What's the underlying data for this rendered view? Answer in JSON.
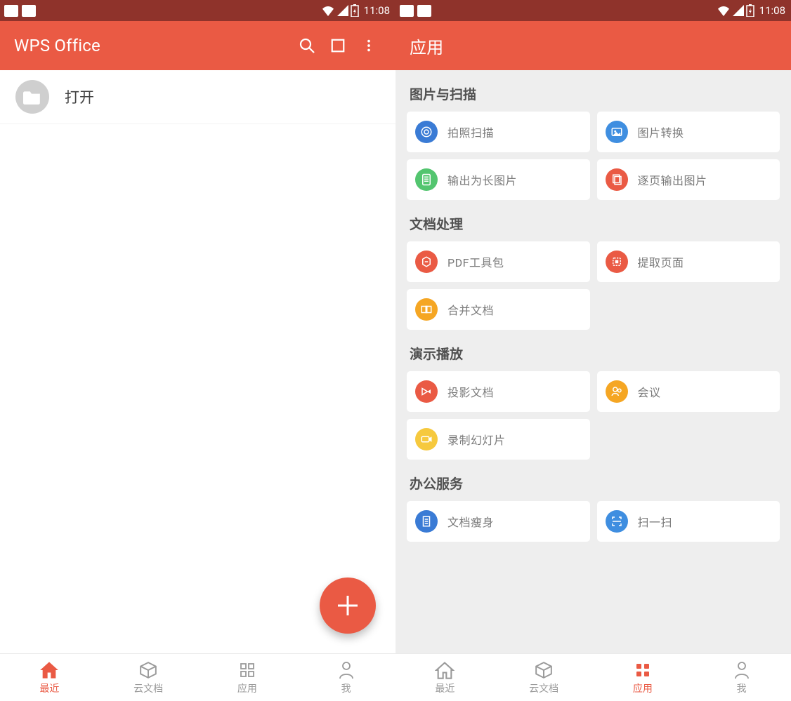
{
  "statusbar": {
    "time": "11:08"
  },
  "left": {
    "title": "WPS Office",
    "open_label": "打开",
    "fab_label": "+"
  },
  "right": {
    "title": "应用",
    "sections": [
      {
        "title": "图片与扫描",
        "items": [
          {
            "label": "拍照扫描",
            "color": "ic-blue",
            "icon": "camera"
          },
          {
            "label": "图片转换",
            "color": "ic-blue2",
            "icon": "image"
          },
          {
            "label": "输出为长图片",
            "color": "ic-green",
            "icon": "long-image"
          },
          {
            "label": "逐页输出图片",
            "color": "ic-red",
            "icon": "pages"
          }
        ]
      },
      {
        "title": "文档处理",
        "items": [
          {
            "label": "PDF工具包",
            "color": "ic-red2",
            "icon": "pdf"
          },
          {
            "label": "提取页面",
            "color": "ic-red",
            "icon": "extract"
          },
          {
            "label": "合并文档",
            "color": "ic-orange",
            "icon": "merge"
          }
        ]
      },
      {
        "title": "演示播放",
        "items": [
          {
            "label": "投影文档",
            "color": "ic-red",
            "icon": "projector"
          },
          {
            "label": "会议",
            "color": "ic-orange",
            "icon": "meeting"
          },
          {
            "label": "录制幻灯片",
            "color": "ic-yellow",
            "icon": "record"
          }
        ]
      },
      {
        "title": "办公服务",
        "items": [
          {
            "label": "文档瘦身",
            "color": "ic-blue",
            "icon": "compress"
          },
          {
            "label": "扫一扫",
            "color": "ic-blue2",
            "icon": "scan"
          }
        ]
      }
    ]
  },
  "nav": {
    "items": [
      {
        "id": "recent",
        "label": "最近"
      },
      {
        "id": "cloud",
        "label": "云文档"
      },
      {
        "id": "apps",
        "label": "应用"
      },
      {
        "id": "me",
        "label": "我"
      }
    ]
  }
}
